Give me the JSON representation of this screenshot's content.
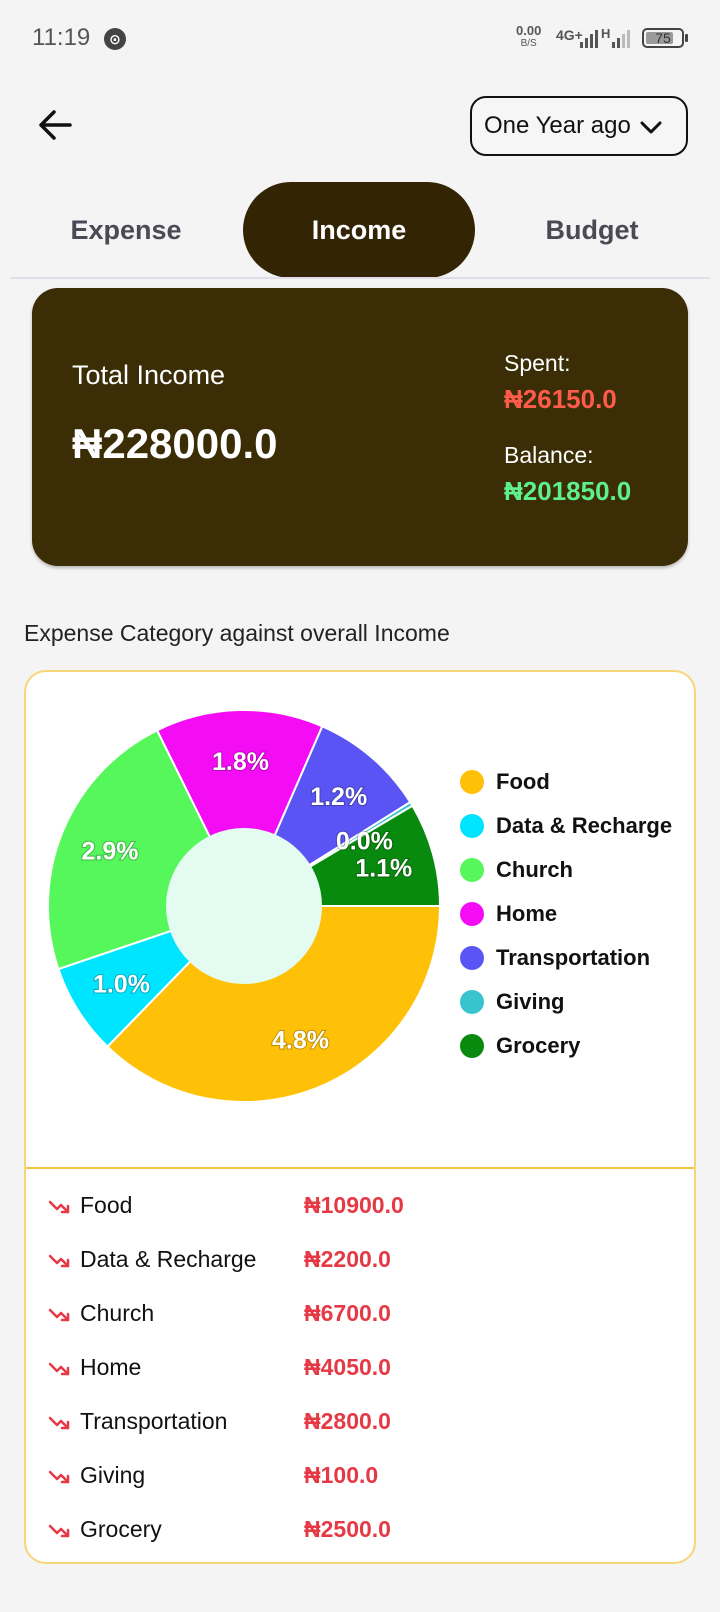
{
  "status_bar": {
    "time": "11:19",
    "net_speed_value": "0.00",
    "net_speed_unit": "B/S",
    "network_type": "4G+",
    "network_h": "H",
    "battery": "75"
  },
  "header": {
    "period_value": "One Year ago"
  },
  "tabs": [
    {
      "label": "Expense",
      "active": false
    },
    {
      "label": "Income",
      "active": true
    },
    {
      "label": "Budget",
      "active": false
    }
  ],
  "summary": {
    "total_label": "Total Income",
    "total_value": "₦228000.0",
    "spent_label": "Spent:",
    "spent_value": "₦26150.0",
    "balance_label": "Balance:",
    "balance_value": "₦201850.0"
  },
  "section_title": "Expense Category against overall Income",
  "chart_data": {
    "type": "pie",
    "donut": true,
    "categories": [
      "Food",
      "Data & Recharge",
      "Church",
      "Home",
      "Transportation",
      "Giving",
      "Grocery"
    ],
    "values": [
      10900,
      2200,
      6700,
      4050,
      2800,
      100,
      2500
    ],
    "labels": [
      "4.8%",
      "1.0%",
      "2.9%",
      "1.8%",
      "1.2%",
      "0.0%",
      "1.1%"
    ],
    "colors": [
      "#ffc107",
      "#00e5ff",
      "#55f75a",
      "#f40cf4",
      "#5b54f4",
      "#38c4cc",
      "#088a0e"
    ],
    "legend": "right"
  },
  "expenses": [
    {
      "name": "Food",
      "amount": "₦10900.0"
    },
    {
      "name": "Data & Recharge",
      "amount": "₦2200.0"
    },
    {
      "name": "Church",
      "amount": "₦6700.0"
    },
    {
      "name": "Home",
      "amount": "₦4050.0"
    },
    {
      "name": "Transportation",
      "amount": "₦2800.0"
    },
    {
      "name": "Giving",
      "amount": "₦100.0"
    },
    {
      "name": "Grocery",
      "amount": "₦2500.0"
    }
  ],
  "icons": {
    "back": "arrow-left-icon",
    "dropdown": "chevron-down-icon",
    "trend": "trending-down-icon"
  }
}
